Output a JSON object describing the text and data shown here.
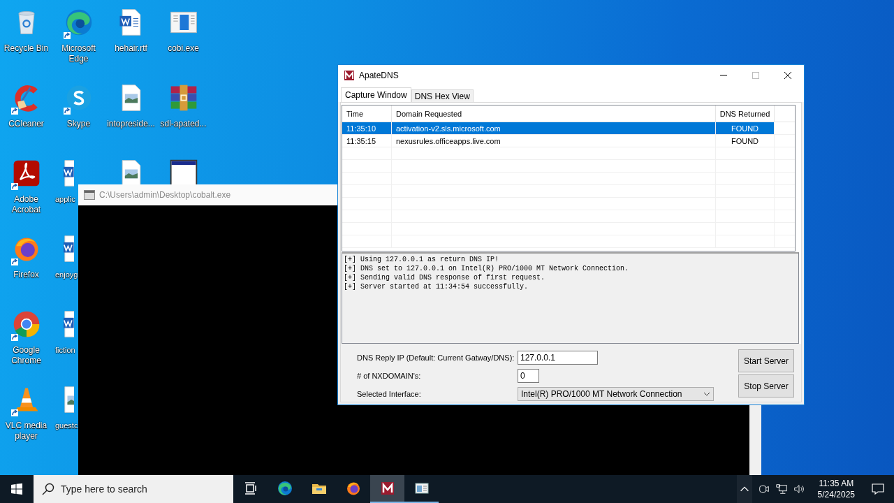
{
  "desktop_columns": [
    [
      {
        "label": "Recycle Bin",
        "kind": "recycle",
        "shortcut": false
      },
      {
        "label": "CCleaner",
        "kind": "ccleaner",
        "shortcut": true
      },
      {
        "label": "Adobe Acrobat",
        "kind": "acrobat",
        "shortcut": true
      },
      {
        "label": "Firefox",
        "kind": "firefox",
        "shortcut": true
      },
      {
        "label": "Google Chrome",
        "kind": "chrome",
        "shortcut": true
      },
      {
        "label": "VLC media player",
        "kind": "vlc",
        "shortcut": true
      }
    ],
    [
      {
        "label": "Microsoft Edge",
        "kind": "edge",
        "shortcut": true
      },
      {
        "label": "Skype",
        "kind": "skype",
        "shortcut": true
      },
      {
        "label": "applic",
        "kind": "word",
        "shortcut": false,
        "partial": true
      },
      {
        "label": "enjoyg",
        "kind": "word",
        "shortcut": false,
        "partial": true
      },
      {
        "label": "fiction",
        "kind": "word",
        "shortcut": false,
        "partial": true
      },
      {
        "label": "guestc",
        "kind": "image",
        "shortcut": false,
        "partial": true
      }
    ],
    [
      {
        "label": "hehair.rtf",
        "kind": "word",
        "shortcut": false
      },
      {
        "label": "intopreside...",
        "kind": "image",
        "shortcut": false
      },
      {
        "kind": "image",
        "shortcut": false
      }
    ],
    [
      {
        "label": "cobi.exe",
        "kind": "exe",
        "shortcut": false
      },
      {
        "label": "sdl-apated...",
        "kind": "winrar",
        "shortcut": false
      },
      {
        "kind": "app",
        "shortcut": false
      }
    ]
  ],
  "console_window": {
    "title": "C:\\Users\\admin\\Desktop\\cobalt.exe"
  },
  "apate_window": {
    "title": "ApateDNS",
    "tabs": [
      {
        "label": "Capture Window",
        "selected": true
      },
      {
        "label": "DNS Hex View",
        "selected": false
      }
    ],
    "table": {
      "columns": [
        "Time",
        "Domain Requested",
        "DNS Returned"
      ],
      "rows": [
        {
          "time": "11:35:10",
          "domain": "activation-v2.sls.microsoft.com",
          "returned": "FOUND",
          "selected": true
        },
        {
          "time": "11:35:15",
          "domain": "nexusrules.officeapps.live.com",
          "returned": "FOUND",
          "selected": false
        }
      ]
    },
    "log": [
      "[+] Using 127.0.0.1 as return DNS IP!",
      "[+] DNS set to 127.0.0.1 on Intel(R) PRO/1000 MT Network Connection.",
      "[+] Sending valid DNS response of first request.",
      "[+] Server started at 11:34:54 successfully."
    ],
    "form": [
      {
        "label": "DNS Reply IP (Default: Current Gatway/DNS):",
        "kind": "ip",
        "value": "127.0.0.1"
      },
      {
        "label": "# of NXDOMAIN's:",
        "kind": "number",
        "value": "0"
      },
      {
        "label": "Selected Interface:",
        "kind": "select",
        "value": "Intel(R) PRO/1000 MT Network Connection"
      }
    ],
    "buttons": [
      "Start Server",
      "Stop Server"
    ]
  },
  "taskbar": {
    "search_placeholder": "Type here to search",
    "apps": [
      {
        "kind": "taskview",
        "active": false,
        "running": false
      },
      {
        "kind": "edge",
        "active": false,
        "running": false
      },
      {
        "kind": "folder",
        "active": false,
        "running": false
      },
      {
        "kind": "firefox",
        "active": false,
        "running": false
      },
      {
        "kind": "apate",
        "active": true,
        "running": true
      },
      {
        "kind": "app",
        "active": false,
        "running": true
      }
    ],
    "clock": {
      "time": "11:35 AM",
      "date": "5/24/2025"
    }
  }
}
